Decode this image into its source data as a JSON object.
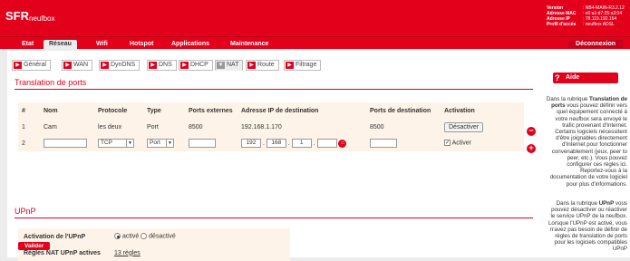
{
  "header": {
    "logo": "SFR",
    "brand": "neufbox",
    "info": [
      {
        "label": "Version",
        "value": "NB4-MAIN-R3.2.12"
      },
      {
        "label": "Adresse MAC",
        "value": "e0:a1:d7:25:a3:04"
      },
      {
        "label": "Adresse IP",
        "value": "78.119.192.164"
      },
      {
        "label": "Profil d'accès",
        "value": "neufbox ADSL"
      }
    ]
  },
  "menu": {
    "items": [
      "Etat",
      "Réseau",
      "Wifi",
      "Hotspot",
      "Applications",
      "Maintenance"
    ],
    "active": "Réseau",
    "logout": "Déconnexion"
  },
  "subtabs": [
    "Général",
    "WAN",
    "DynDNS",
    "DNS",
    "DHCP",
    "NAT",
    "Route",
    "Filtrage"
  ],
  "nat": {
    "title": "Translation de ports",
    "headers": [
      "#",
      "Nom",
      "Protocole",
      "Type",
      "Ports externes",
      "Adresse IP de destination",
      "Ports de destination",
      "Activation"
    ],
    "row1": {
      "num": "1",
      "nom": "Cam",
      "protocole": "les deux",
      "type": "Port",
      "ports_ext": "8500",
      "ip": "192.168.1.170",
      "ports_dest": "8500",
      "action": "Désactiver"
    },
    "row2": {
      "num": "2",
      "protocole": "TCP",
      "type": "Port",
      "ip1": "192",
      "ip2": "168",
      "ip3": "1",
      "activer": "Activer"
    }
  },
  "upnp": {
    "title": "UPnP",
    "activation_label": "Activation de l'UPnP",
    "opt_on": "activé",
    "opt_off": "désactivé",
    "selected": "activé",
    "rules_label": "Règles NAT UPnP actives",
    "rules_value": "13 règles",
    "submit": "Valider"
  },
  "help": {
    "button": "Aide",
    "p1_pre": "Dans la rubrique ",
    "p1_bold": "Translation de ports",
    "p1_post": " vous pouvez définir vers quel équipement connecté à votre neufbox sera envoyé le trafic provenant d'Internet. Certains logiciels nécessitent d'être joignables directement d'Internet pour fonctionner convenablement (jeux, peer to peer, etc.). Vous pouvez configurer ces règles ici. Reportez-vous à la documentation de votre logiciel pour plus d'informations.",
    "p2_pre": "Dans la rubrique ",
    "p2_bold": "UPnP",
    "p2_post": " vous pouvez désactiver ou réactiver le service UPnP de la neufbox. Lorsque l'UPnP est activé, vous n'avez pas besoin de définir de règles de translation de ports pour les logiciels compatibles UPnP"
  },
  "colors": {
    "brand_red": "#e3001b",
    "table_bg": "#fdf3e8"
  }
}
